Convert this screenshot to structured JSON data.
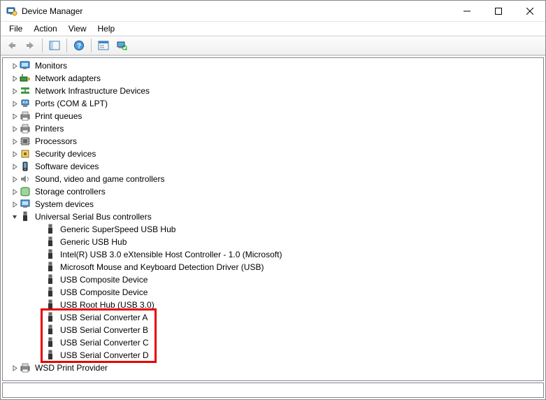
{
  "window": {
    "title": "Device Manager"
  },
  "menu": {
    "file": "File",
    "action": "Action",
    "view": "View",
    "help": "Help"
  },
  "toolbar": {
    "back": "Back",
    "forward": "Forward",
    "show_hide": "Show/Hide Console Tree",
    "help": "Help",
    "properties": "Properties",
    "scan": "Scan for hardware changes"
  },
  "categories": [
    {
      "id": "monitors",
      "label": "Monitors",
      "icon": "monitor"
    },
    {
      "id": "network-adapters",
      "label": "Network adapters",
      "icon": "network"
    },
    {
      "id": "network-infra",
      "label": "Network Infrastructure Devices",
      "icon": "network-infra"
    },
    {
      "id": "ports",
      "label": "Ports (COM & LPT)",
      "icon": "port"
    },
    {
      "id": "print-queues",
      "label": "Print queues",
      "icon": "printer"
    },
    {
      "id": "printers",
      "label": "Printers",
      "icon": "printer"
    },
    {
      "id": "processors",
      "label": "Processors",
      "icon": "cpu"
    },
    {
      "id": "security-devices",
      "label": "Security devices",
      "icon": "security"
    },
    {
      "id": "software-devices",
      "label": "Software devices",
      "icon": "software"
    },
    {
      "id": "sound",
      "label": "Sound, video and game controllers",
      "icon": "sound"
    },
    {
      "id": "storage-controllers",
      "label": "Storage controllers",
      "icon": "storage"
    },
    {
      "id": "system-devices",
      "label": "System devices",
      "icon": "system"
    },
    {
      "id": "usb-controllers",
      "label": "Universal Serial Bus controllers",
      "icon": "usb",
      "expanded": true,
      "children": [
        {
          "label": "Generic SuperSpeed USB Hub"
        },
        {
          "label": "Generic USB Hub"
        },
        {
          "label": "Intel(R) USB 3.0 eXtensible Host Controller - 1.0 (Microsoft)"
        },
        {
          "label": "Microsoft Mouse and Keyboard Detection Driver (USB)"
        },
        {
          "label": "USB Composite Device"
        },
        {
          "label": "USB Composite Device"
        },
        {
          "label": "USB Root Hub (USB 3.0)"
        },
        {
          "label": "USB Serial Converter A",
          "highlight": true
        },
        {
          "label": "USB Serial Converter B",
          "highlight": true
        },
        {
          "label": "USB Serial Converter C",
          "highlight": true
        },
        {
          "label": "USB Serial Converter D",
          "highlight": true
        }
      ]
    },
    {
      "id": "wsd-print",
      "label": "WSD Print Provider",
      "icon": "printer"
    }
  ]
}
